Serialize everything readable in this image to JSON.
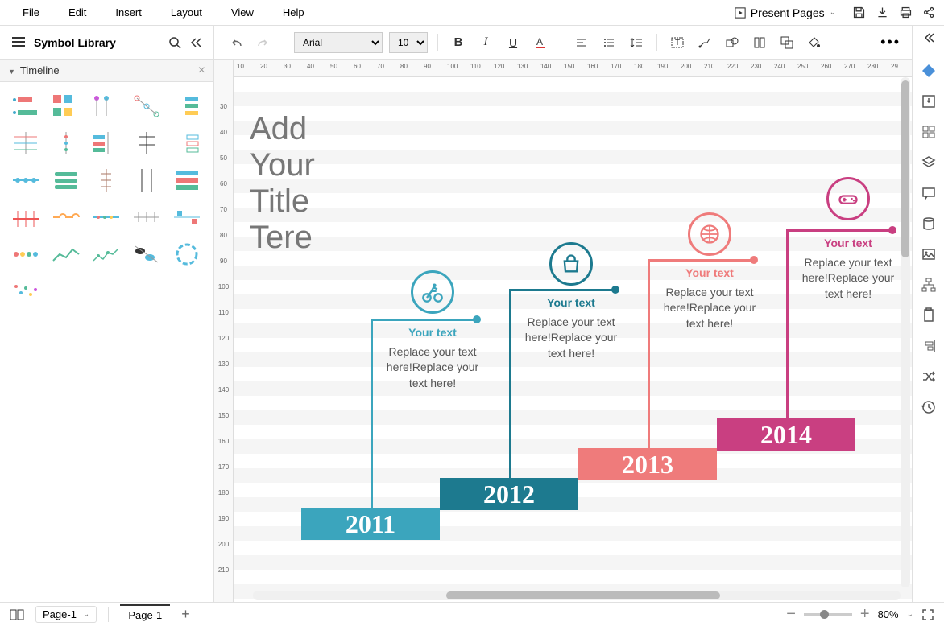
{
  "menubar": {
    "items": [
      "File",
      "Edit",
      "Insert",
      "Layout",
      "View",
      "Help"
    ],
    "present_label": "Present Pages"
  },
  "left_panel": {
    "title": "Symbol Library",
    "category": "Timeline"
  },
  "toolbar": {
    "font": "Arial",
    "size": "10"
  },
  "ruler_h": [
    "10",
    "20",
    "30",
    "40",
    "50",
    "60",
    "70",
    "80",
    "90",
    "100",
    "110",
    "120",
    "130",
    "140",
    "150",
    "160",
    "170",
    "180",
    "190",
    "200",
    "210",
    "220",
    "230",
    "240",
    "250",
    "260",
    "270",
    "280",
    "29"
  ],
  "ruler_v": [
    "30",
    "40",
    "50",
    "60",
    "70",
    "80",
    "90",
    "100",
    "110",
    "120",
    "130",
    "140",
    "150",
    "160",
    "170",
    "180",
    "190",
    "200",
    "210"
  ],
  "diagram": {
    "title": "Add Your Title Tere",
    "steps": [
      {
        "year": "2011",
        "heading": "Your text",
        "body": "Replace your text here!Replace your text here!",
        "color": "#3ba5bd",
        "dark": "#1d7a8f"
      },
      {
        "year": "2012",
        "heading": "Your text",
        "body": "Replace your text here!Replace your text here!",
        "color": "#1d7a8f",
        "dark": "#15606f"
      },
      {
        "year": "2013",
        "heading": "Your text",
        "body": "Replace your text here!Replace your text here!",
        "color": "#ef7b7b",
        "dark": "#d85a5a"
      },
      {
        "year": "2014",
        "heading": "Your text",
        "body": "Replace your text here!Replace your text here!",
        "color": "#c93f81",
        "dark": "#a82d68"
      }
    ]
  },
  "footer": {
    "page_selector": "Page-1",
    "page_tab": "Page-1",
    "zoom": "80%"
  }
}
